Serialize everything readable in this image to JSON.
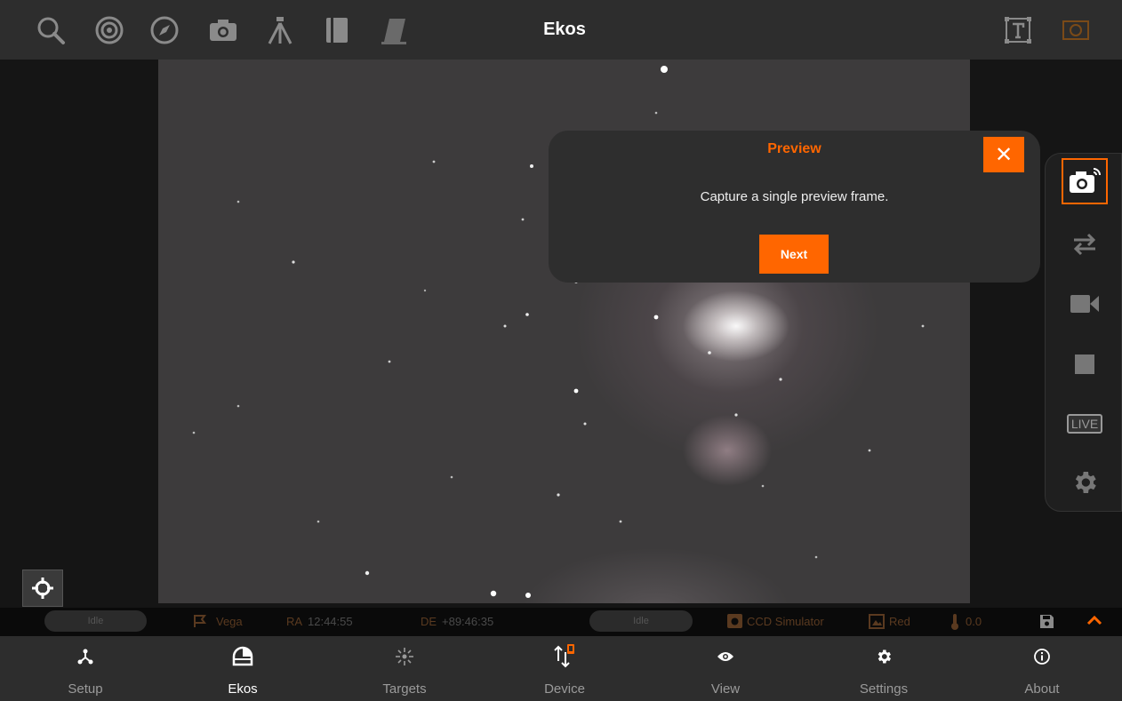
{
  "app": {
    "title": "Ekos"
  },
  "toolbar": {
    "icons": [
      "search-icon",
      "target-icon",
      "compass-icon",
      "camera-icon",
      "telescope-icon",
      "book-icon",
      "filter-icon",
      "text-frame-icon",
      "frame-icon"
    ]
  },
  "tour": {
    "title": "Preview",
    "message": "Capture a single preview frame.",
    "next_label": "Next",
    "close_symbol": "✕"
  },
  "capture_panel": {
    "live_label": "LIVE"
  },
  "status": {
    "mount_state": "Idle",
    "target": "Vega",
    "ra_label": "RA",
    "ra_value": "12:44:55",
    "de_label": "DE",
    "de_value": "+89:46:35",
    "camera_state": "Idle",
    "camera": "CCD Simulator",
    "filter": "Red",
    "temperature": "0.0"
  },
  "nav": {
    "items": [
      {
        "label": "Setup",
        "icon": "setup-icon"
      },
      {
        "label": "Ekos",
        "icon": "ekos-icon"
      },
      {
        "label": "Targets",
        "icon": "targets-icon"
      },
      {
        "label": "Device",
        "icon": "device-icon"
      },
      {
        "label": "View",
        "icon": "eye-icon"
      },
      {
        "label": "Settings",
        "icon": "gear-icon"
      },
      {
        "label": "About",
        "icon": "info-icon"
      }
    ],
    "active": "Ekos"
  },
  "colors": {
    "accent": "#ff6600",
    "bar": "#2d2d2d",
    "icon_inactive": "#8a8a8a"
  }
}
